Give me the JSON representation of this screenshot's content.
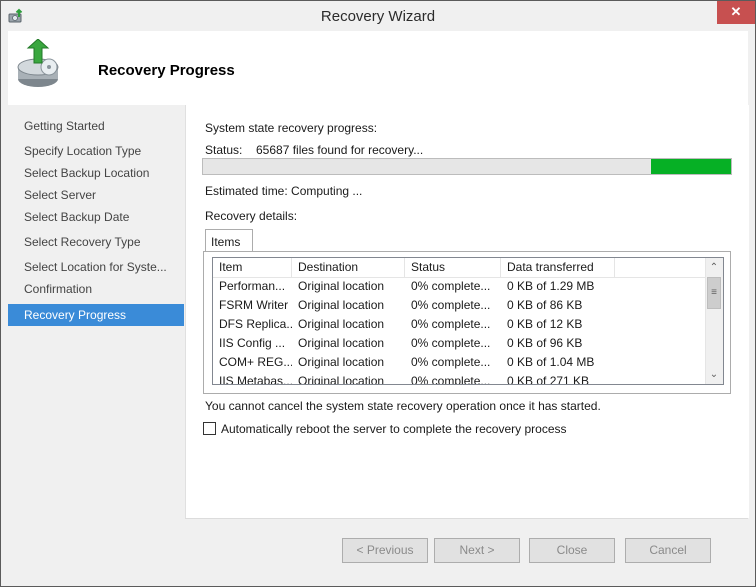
{
  "window": {
    "title": "Recovery Wizard",
    "close_glyph": "✕"
  },
  "header": {
    "title": "Recovery Progress"
  },
  "sidebar": {
    "items": [
      {
        "label": "Getting Started"
      },
      {
        "label": "Specify Location Type"
      },
      {
        "label": "Select Backup Location"
      },
      {
        "label": "Select Server"
      },
      {
        "label": "Select Backup Date"
      },
      {
        "label": "Select Recovery Type"
      },
      {
        "label": "Select Location for Syste..."
      },
      {
        "label": "Confirmation"
      },
      {
        "label": "Recovery Progress",
        "active": true
      }
    ]
  },
  "main": {
    "progress_heading": "System state recovery progress:",
    "status_label": "Status:",
    "status_value": "65687 files found for recovery...",
    "estimated_time": "Estimated time: Computing ...",
    "details_label": "Recovery details:",
    "tab_label": "Items",
    "columns": [
      "Item",
      "Destination",
      "Status",
      "Data transferred"
    ],
    "rows": [
      [
        "Performan...",
        "Original location",
        "0% complete...",
        "0 KB of 1.29 MB"
      ],
      [
        "FSRM Writer",
        "Original location",
        "0% complete...",
        "0 KB of 86 KB"
      ],
      [
        "DFS Replica...",
        "Original location",
        "0% complete...",
        "0 KB of 12 KB"
      ],
      [
        "IIS Config ...",
        "Original location",
        "0% complete...",
        "0 KB of 96 KB"
      ],
      [
        "COM+ REG...",
        "Original location",
        "0% complete...",
        "0 KB of 1.04 MB"
      ],
      [
        "IIS Metabas...",
        "Original location",
        "0% complete...",
        "0 KB of 271 KB"
      ]
    ],
    "cancel_note": "You cannot cancel the system state recovery operation once it has started.",
    "reboot_checkbox_label": "Automatically reboot the server to complete the recovery process",
    "reboot_checked": false
  },
  "footer": {
    "previous_label": "< Previous",
    "next_label": "Next >",
    "close_label": "Close",
    "cancel_label": "Cancel"
  },
  "scrollbar": {
    "up_glyph": "⌃",
    "down_glyph": "⌄",
    "grip_glyph": "≡"
  },
  "colors": {
    "accent": "#3a8bd8",
    "progress": "#06b025",
    "close_button": "#c75050"
  }
}
